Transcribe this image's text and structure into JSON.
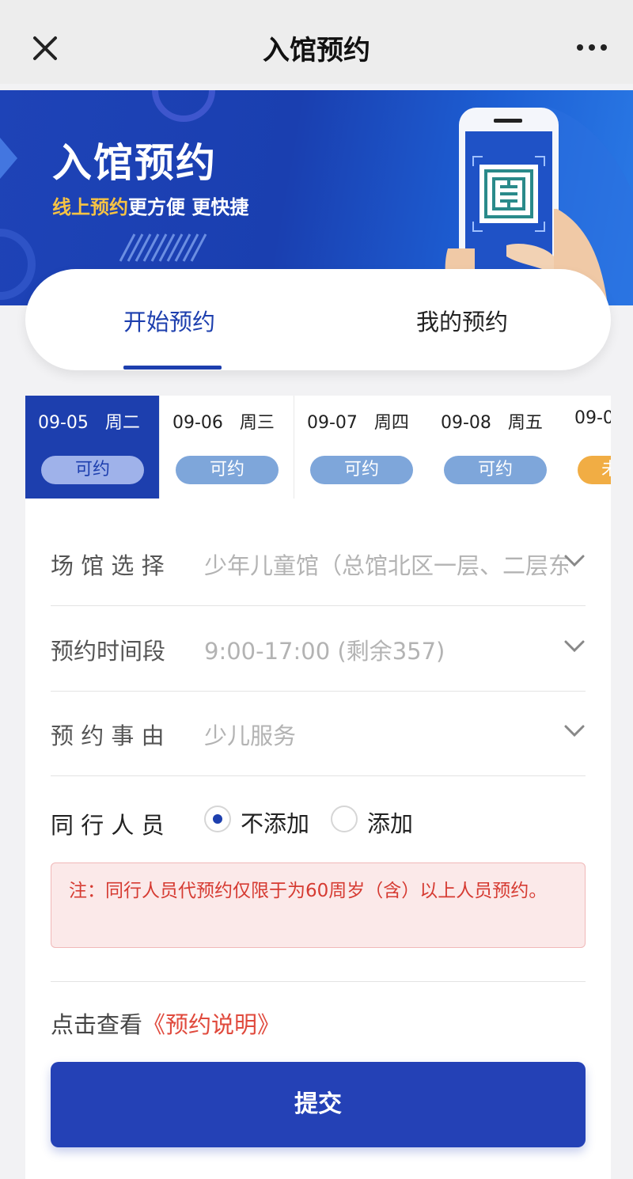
{
  "nav": {
    "title": "入馆预约",
    "close_icon": "close-icon",
    "more_icon": "more-icon"
  },
  "banner": {
    "title": "入馆预约",
    "subtitle_highlight": "线上预约",
    "subtitle_rest": "更方便 更快捷",
    "highlight_color": "#f6c344"
  },
  "tabs": {
    "start": "开始预约",
    "mine": "我的预约",
    "active": "start"
  },
  "dates": [
    {
      "date": "09-05",
      "weekday": "周二",
      "status": "可约",
      "active": true
    },
    {
      "date": "09-06",
      "weekday": "周三",
      "status": "可约",
      "active": false
    },
    {
      "date": "09-07",
      "weekday": "周四",
      "status": "可约",
      "active": false
    },
    {
      "date": "09-08",
      "weekday": "周五",
      "status": "可约",
      "active": false
    },
    {
      "date": "09-0",
      "weekday": "",
      "status": "未",
      "active": false
    }
  ],
  "form": {
    "venue": {
      "label": "场 馆 选 择",
      "value": "少年儿童馆（总馆北区一层、二层东"
    },
    "time": {
      "label": "预约时间段",
      "value": "9:00-17:00 (剩余357)"
    },
    "reason": {
      "label": "预 约 事 由",
      "value": "少儿服务"
    },
    "companion": {
      "label": "同 行 人 员",
      "options": [
        {
          "label": "不添加",
          "selected": true
        },
        {
          "label": "添加",
          "selected": false
        }
      ]
    }
  },
  "notice": {
    "text": "注：同行人员代预约仅限于为60周岁（含）以上人员预约。"
  },
  "terms": {
    "prefix": "点击查看",
    "link": "《预约说明》"
  },
  "submit": {
    "label": "提交"
  },
  "colors": {
    "primary": "#1d3fae",
    "notice_text": "#d63b32",
    "notice_bg": "#fbe9e9"
  }
}
